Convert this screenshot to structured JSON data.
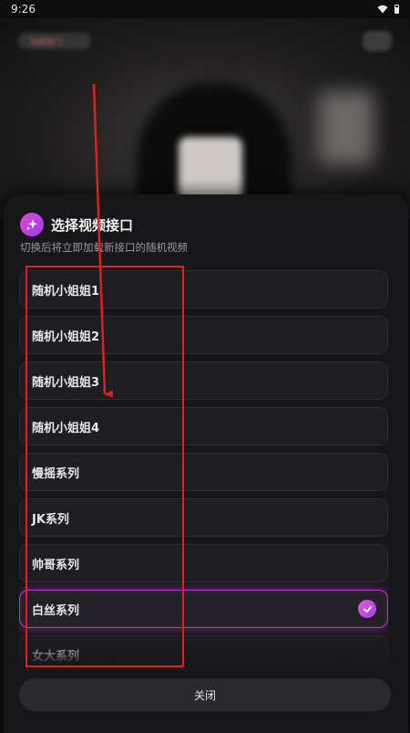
{
  "status_bar": {
    "time": "9:26"
  },
  "background": {
    "live_badge": "当前热门"
  },
  "sheet": {
    "title": "选择视频接口",
    "subtitle": "切换后将立即加载新接口的随机视频",
    "options": [
      {
        "label": "随机小姐姐1",
        "selected": false
      },
      {
        "label": "随机小姐姐2",
        "selected": false
      },
      {
        "label": "随机小姐姐3",
        "selected": false
      },
      {
        "label": "随机小姐姐4",
        "selected": false
      },
      {
        "label": "慢摇系列",
        "selected": false
      },
      {
        "label": "JK系列",
        "selected": false
      },
      {
        "label": "帅哥系列",
        "selected": false
      },
      {
        "label": "白丝系列",
        "selected": true
      },
      {
        "label": "女大系列",
        "selected": false
      }
    ],
    "close_label": "关闭"
  },
  "colors": {
    "accent": "#c84ad8",
    "annotation": "#e0201c"
  }
}
